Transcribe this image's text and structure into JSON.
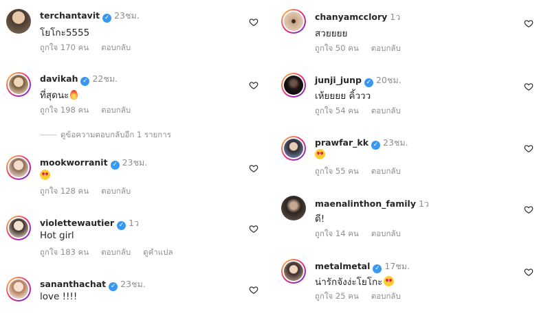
{
  "left": [
    {
      "username": "terchantavit",
      "time": "23ชม.",
      "text": "โยโกะ5555",
      "likes": "ถูกใจ 170 คน",
      "reply": "ตอบกลับ"
    },
    {
      "username": "davikah",
      "time": "22ชม.",
      "text": "ที่สุดนะ",
      "likes": "ถูกใจ 198 คน",
      "reply": "ตอบกลับ",
      "view_replies": "ดูข้อความตอบกลับอีก 1 รายการ"
    },
    {
      "username": "mookworranit",
      "time": "23ชม.",
      "text": "",
      "likes": "ถูกใจ 128 คน",
      "reply": "ตอบกลับ"
    },
    {
      "username": "violettewautier",
      "time": "1ว",
      "text": "Hot girl",
      "likes": "ถูกใจ 183 คน",
      "reply": "ตอบกลับ",
      "translate": "ดูคำแปล"
    },
    {
      "username": "sananthachat",
      "time": "23ชม.",
      "text": "love !!!!"
    }
  ],
  "right": [
    {
      "username": "chanyamcclory",
      "time": "1ว",
      "text": "สวยยยย",
      "likes": "ถูกใจ 50 คน",
      "reply": "ตอบกลับ"
    },
    {
      "username": "junji_junp",
      "time": "20ชม.",
      "text": "เห้ยยยย คิ้ววว",
      "likes": "ถูกใจ 54 คน",
      "reply": "ตอบกลับ"
    },
    {
      "username": "prawfar_kk",
      "time": "23ชม.",
      "text": "",
      "likes": "ถูกใจ 55 คน",
      "reply": "ตอบกลับ"
    },
    {
      "username": "maenalinthon_family",
      "time": "1ว",
      "text": "ดี!",
      "likes": "ถูกใจ 14 คน",
      "reply": "ตอบกลับ"
    },
    {
      "username": "metalmetal",
      "time": "17ชม.",
      "text": "น่ารักจังง่ะโยโกะ",
      "likes": "ถูกใจ 25 คน",
      "reply": "ตอบกลับ"
    }
  ],
  "colors": {
    "verified": "#3897f0",
    "muted": "#8e8e8e",
    "text": "#262626"
  }
}
